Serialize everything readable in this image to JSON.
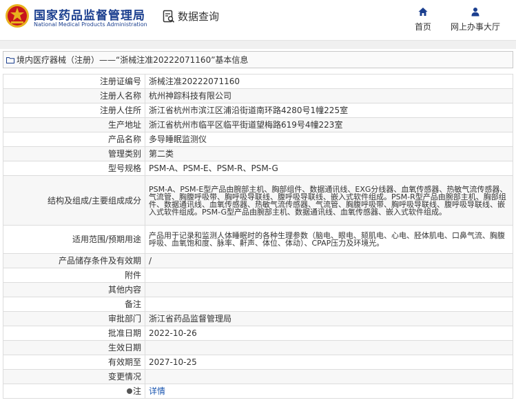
{
  "header": {
    "brand_cn": "国家药品监督管理局",
    "brand_en": "National Medical Products Administration",
    "data_query": "数据查询",
    "nav": [
      {
        "label": "首页",
        "icon": "home-icon"
      },
      {
        "label": "网上办事大厅",
        "icon": "person-icon"
      }
    ]
  },
  "colors": {
    "brand": "#1b3f8f",
    "logo_red": "#c8161d",
    "logo_gold": "#e8b21e",
    "link": "#1b56b0"
  },
  "title": "境内医疗器械（注册）——“浙械注准20222071160”基本信息",
  "rows": [
    {
      "key": "注册证编号",
      "value": "浙械注准20222071160"
    },
    {
      "key": "注册人名称",
      "value": "杭州神踪科技有限公司"
    },
    {
      "key": "注册人住所",
      "value": "浙江省杭州市滨江区浦沿街道南环路4280号1幢225室"
    },
    {
      "key": "生产地址",
      "value": "浙江省杭州市临平区临平街道望梅路619号4幢223室"
    },
    {
      "key": "产品名称",
      "value": "多导睡眠监测仪"
    },
    {
      "key": "管理类别",
      "value": "第二类"
    },
    {
      "key": "型号规格",
      "value": "PSM-A、PSM-E、PSM-R、PSM-G"
    },
    {
      "key": "结构及组成/主要组成成分",
      "value": "PSM-A、PSM-E型产品由腕部主机、胸部组件、数据通讯线、EXG分线器、血氧传感器、热敏气流传感器、气流管、胸腹呼吸带、胸呼吸导联线、腹呼吸导联线、嵌入式软件组成。PSM-R型产品由腕部主机、胸部组件、数据通讯线、血氧传感器、热敏气流传感器、气流管、胸腹呼吸带、胸呼吸导联线、腹呼吸导联线、嵌入式软件组成。PSM-G型产品由腕部主机、数据通讯线、血氧传感器、嵌入式软件组成。"
    },
    {
      "key": "适用范围/预期用途",
      "value": "产品用于记录和监测人体睡眠时的各种生理参数（脑电、眼电、颏肌电、心电、胫体肌电、口鼻气流、胸腹呼吸、血氧饱和度、脉率、鼾声、体位、体动）、CPAP压力及环境光。"
    },
    {
      "key": "产品储存条件及有效期",
      "value": "/"
    },
    {
      "key": "附件",
      "value": ""
    },
    {
      "key": "其他内容",
      "value": ""
    },
    {
      "key": "备注",
      "value": ""
    },
    {
      "key": "审批部门",
      "value": "浙江省药品监督管理局"
    },
    {
      "key": "批准日期",
      "value": "2022-10-26"
    },
    {
      "key": "生效日期",
      "value": ""
    },
    {
      "key": "有效期至",
      "value": "2027-10-25"
    },
    {
      "key": "变更情况",
      "value": ""
    },
    {
      "key": "注",
      "value": "详情"
    }
  ]
}
